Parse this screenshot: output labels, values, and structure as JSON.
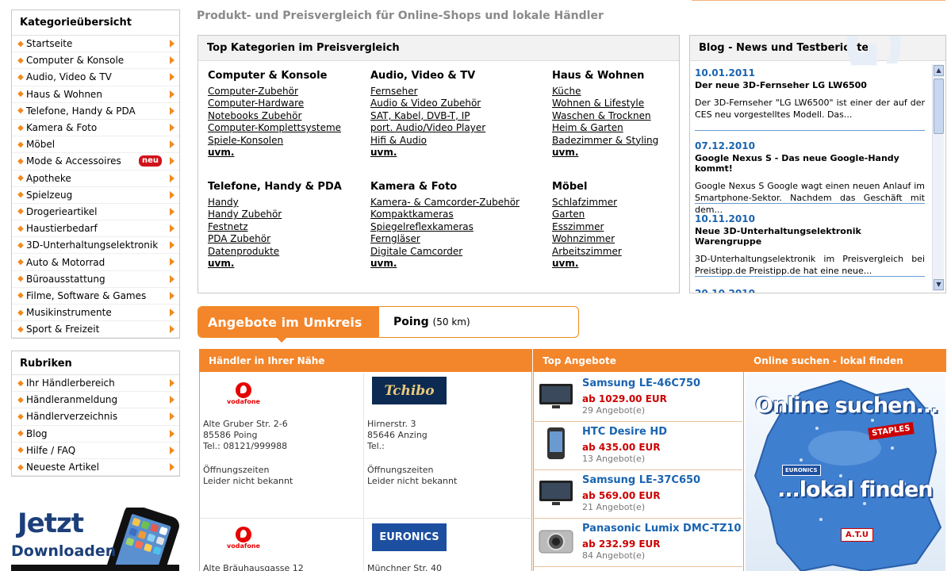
{
  "header": {
    "tagline": "Produkt- und Preisvergleich für Online-Shops und lokale Händler"
  },
  "sidebar": {
    "categories_title": "Kategorieübersicht",
    "categories": [
      {
        "label": "Startseite"
      },
      {
        "label": "Computer & Konsole"
      },
      {
        "label": "Audio, Video & TV"
      },
      {
        "label": "Haus & Wohnen"
      },
      {
        "label": "Telefone, Handy & PDA"
      },
      {
        "label": "Kamera & Foto"
      },
      {
        "label": "Möbel"
      },
      {
        "label": "Mode & Accessoires",
        "badge": "neu"
      },
      {
        "label": "Apotheke"
      },
      {
        "label": "Spielzeug"
      },
      {
        "label": "Drogerieartikel"
      },
      {
        "label": "Haustierbedarf"
      },
      {
        "label": "3D-Unterhaltungselektronik"
      },
      {
        "label": "Auto & Motorrad"
      },
      {
        "label": "Büroausstattung"
      },
      {
        "label": "Filme, Software & Games"
      },
      {
        "label": "Musikinstrumente"
      },
      {
        "label": "Sport & Freizeit"
      }
    ],
    "rubriken_title": "Rubriken",
    "rubriken": [
      {
        "label": "Ihr Händlerbereich"
      },
      {
        "label": "Händleranmeldung"
      },
      {
        "label": "Händlerverzeichnis"
      },
      {
        "label": "Blog"
      },
      {
        "label": "Hilfe / FAQ"
      },
      {
        "label": "Neueste Artikel"
      }
    ],
    "promo": {
      "line1": "Jetzt",
      "line2": "Downloaden"
    }
  },
  "top_categories": {
    "title": "Top Kategorien im Preisvergleich",
    "more_label": "uvm.",
    "groups": [
      {
        "title": "Computer & Konsole",
        "links": [
          "Computer-Zubehör",
          "Computer-Hardware",
          "Notebooks Zubehör",
          "Computer-Komplettsysteme",
          "Spiele-Konsolen"
        ]
      },
      {
        "title": "Audio, Video & TV",
        "links": [
          "Fernseher",
          "Audio & Video Zubehör",
          "SAT, Kabel, DVB-T, IP",
          "port. Audio/Video Player",
          "Hifi & Audio"
        ]
      },
      {
        "title": "Haus & Wohnen",
        "links": [
          "Küche",
          "Wohnen & Lifestyle",
          "Waschen & Trocknen",
          "Heim & Garten",
          "Badezimmer & Styling"
        ]
      },
      {
        "title": "Telefone, Handy & PDA",
        "links": [
          "Handy",
          "Handy Zubehör",
          "Festnetz",
          "PDA Zubehör",
          "Datenprodukte"
        ]
      },
      {
        "title": "Kamera & Foto",
        "links": [
          "Kamera- & Camcorder-Zubehör",
          "Kompaktkameras",
          "Spiegelreflexkameras",
          "Ferngläser",
          "Digitale Camcorder"
        ]
      },
      {
        "title": "Möbel",
        "links": [
          "Schlafzimmer",
          "Garten",
          "Esszimmer",
          "Wohnzimmer",
          "Arbeitszimmer"
        ]
      }
    ]
  },
  "blog": {
    "title": "Blog - News und Testberichte",
    "watermark": "BLOG",
    "entries": [
      {
        "date": "10.01.2011",
        "headline": "Der neue 3D-Fernseher LG LW6500",
        "text": "Der 3D-Fernseher \"LG LW6500\" ist einer der auf der CES neu vorgestelltes Modell. Das..."
      },
      {
        "date": "07.12.2010",
        "headline": "Google Nexus S - Das neue Google-Handy kommt!",
        "text": "Google Nexus S Google wagt einen neuen Anlauf im Smartphone-Sektor. Nachdem das Geschäft mit dem..."
      },
      {
        "date": "10.11.2010",
        "headline": "Neue 3D-Unterhaltungselektronik Warengruppe",
        "text": "3D-Unterhaltungselektronik im Preisvergleich bei Preistipp.de Preistipp.de hat eine neue..."
      },
      {
        "date": "20.10.2010",
        "headline": "",
        "text": ""
      }
    ]
  },
  "angebote": {
    "title": "Angebote im Umkreis",
    "location": "Poing",
    "radius": "(50 km)"
  },
  "dealers": {
    "title": "Händler in Ihrer Nähe",
    "items": [
      {
        "logo": "vodafone",
        "street": "Alte Gruber Str. 2-6",
        "city": "85586 Poing",
        "phone": "Tel.: 08121/999988",
        "hours_label": "Öffnungszeiten",
        "hours": "Leider nicht bekannt"
      },
      {
        "logo": "Tchibo",
        "street": "Hirnerstr. 3",
        "city": "85646 Anzing",
        "phone": "Tel.:",
        "hours_label": "Öffnungszeiten",
        "hours": "Leider nicht bekannt"
      },
      {
        "logo": "vodafone",
        "street": "Alte Bräuhausgasse 12",
        "city": "",
        "phone": "",
        "hours_label": "",
        "hours": ""
      },
      {
        "logo": "EURONICS",
        "street": "Münchner Str. 40",
        "city": "",
        "phone": "",
        "hours_label": "",
        "hours": ""
      }
    ]
  },
  "top_offers": {
    "title": "Top Angebote",
    "items": [
      {
        "name": "Samsung LE-46C750",
        "price": "ab 1029.00 EUR",
        "count": "29 Angebot(e)",
        "icon": "tv-icon"
      },
      {
        "name": "HTC Desire HD",
        "price": "ab 435.00 EUR",
        "count": "13 Angebot(e)",
        "icon": "phone-icon"
      },
      {
        "name": "Samsung LE-37C650",
        "price": "ab 569.00 EUR",
        "count": "21 Angebot(e)",
        "icon": "tv-icon"
      },
      {
        "name": "Panasonic Lumix DMC-TZ10",
        "price": "ab 232.99 EUR",
        "count": "84 Angebot(e)",
        "icon": "camera-icon"
      }
    ]
  },
  "local_search": {
    "title": "Online suchen - lokal finden",
    "line1": "Online suchen...",
    "line2": "...lokal finden",
    "brands": [
      "STAPLES",
      "EURONICS",
      "A.T.U"
    ]
  },
  "colors": {
    "accent": "#f3852a",
    "link_blue": "#1a64b0",
    "price_red": "#cc0000",
    "badge_red": "#d0121a"
  }
}
